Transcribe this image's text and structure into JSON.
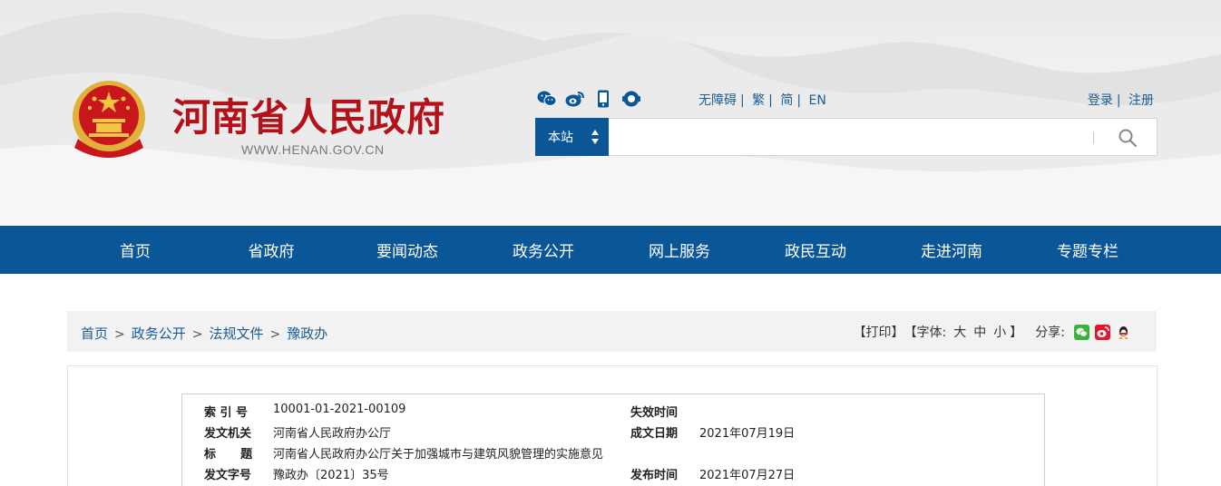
{
  "header": {
    "site_title": "河南省人民政府",
    "site_url": "WWW.HENAN.GOV.CN",
    "social_icons": [
      "wechat-icon",
      "weibo-icon",
      "mobile-icon",
      "service-icon"
    ],
    "lang_links": [
      "无障碍",
      "繁",
      "简",
      "EN"
    ],
    "account_links": [
      "登录",
      "注册"
    ],
    "search": {
      "scope": "本站",
      "placeholder": ""
    }
  },
  "nav": {
    "items": [
      "首页",
      "省政府",
      "要闻动态",
      "政务公开",
      "网上服务",
      "政民互动",
      "走进河南",
      "专题专栏"
    ]
  },
  "breadcrumb": {
    "items": [
      "首页",
      "政务公开",
      "法规文件",
      "豫政办"
    ],
    "separator": ">"
  },
  "tools": {
    "print": "【打印】",
    "font_label": "【字体:",
    "font_large": "大",
    "font_medium": "中",
    "font_small": "小",
    "font_close": "】",
    "share_label": "分享:",
    "share_icons": [
      "wechat-share-icon",
      "weibo-share-icon",
      "qq-share-icon"
    ]
  },
  "meta": {
    "index_label": "索 引 号",
    "index_value": "10001-01-2021-00109",
    "expire_label": "失效时间",
    "expire_value": "",
    "issuer_label": "发文机关",
    "issuer_value": "河南省人民政府办公厅",
    "written_label": "成文日期",
    "written_value": "2021年07月19日",
    "title_label": "标      题",
    "title_value": "河南省人民政府办公厅关于加强城市与建筑风貌管理的实施意见",
    "docno_label": "发文字号",
    "docno_value": "豫政办〔2021〕35号",
    "publish_label": "发布时间",
    "publish_value": "2021年07月27日"
  },
  "colors": {
    "brand_blue": "#0b5697",
    "title_red": "#b3121a",
    "link_blue": "#1a5e97"
  }
}
